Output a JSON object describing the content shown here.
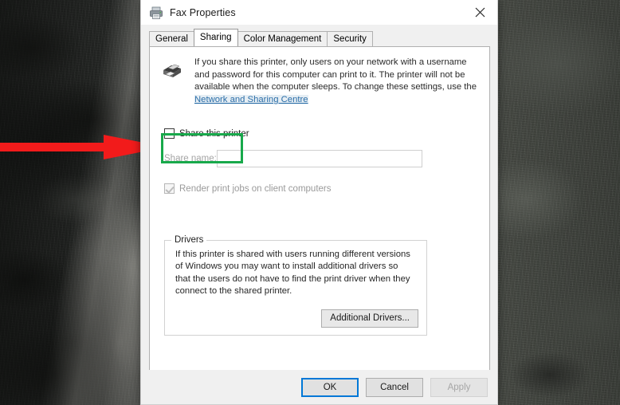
{
  "window": {
    "title": "Fax Properties",
    "title_icon": "printer-icon",
    "close_icon": "close-icon"
  },
  "tabs": [
    {
      "label": "General",
      "selected": false
    },
    {
      "label": "Sharing",
      "selected": true
    },
    {
      "label": "Color Management",
      "selected": false
    },
    {
      "label": "Security",
      "selected": false
    }
  ],
  "sharing_tab": {
    "info_icon": "shared-printer-icon",
    "info_text_before_link": "If you share this printer, only users on your network with a username and password for this computer can print to it. The printer will not be available when the computer sleeps. To change these settings, use the ",
    "info_link_label": "Network and Sharing Centre",
    "share_printer_checkbox": {
      "label": "Share this printer",
      "checked": false,
      "highlighted": true
    },
    "share_name": {
      "label": "Share name:",
      "value": "",
      "placeholder": "",
      "disabled": true
    },
    "render_checkbox": {
      "label": "Render print jobs on client computers",
      "checked": true,
      "disabled": true
    },
    "drivers_group": {
      "title": "Drivers",
      "description": "If this printer is shared with users running different versions of Windows you may want to install additional drivers so that the users do not have to find the print driver when they connect to the shared printer.",
      "button_label": "Additional Drivers..."
    }
  },
  "footer": {
    "ok_label": "OK",
    "cancel_label": "Cancel",
    "apply_label": "Apply"
  },
  "annotations": {
    "arrow_color": "#f21b1b",
    "highlight_color": "#18a94b"
  },
  "theme": {
    "accent": "#0078d7",
    "link": "#2b6ea8",
    "dialog_bg": "#f0f0f0",
    "panel_bg": "#ffffff"
  }
}
